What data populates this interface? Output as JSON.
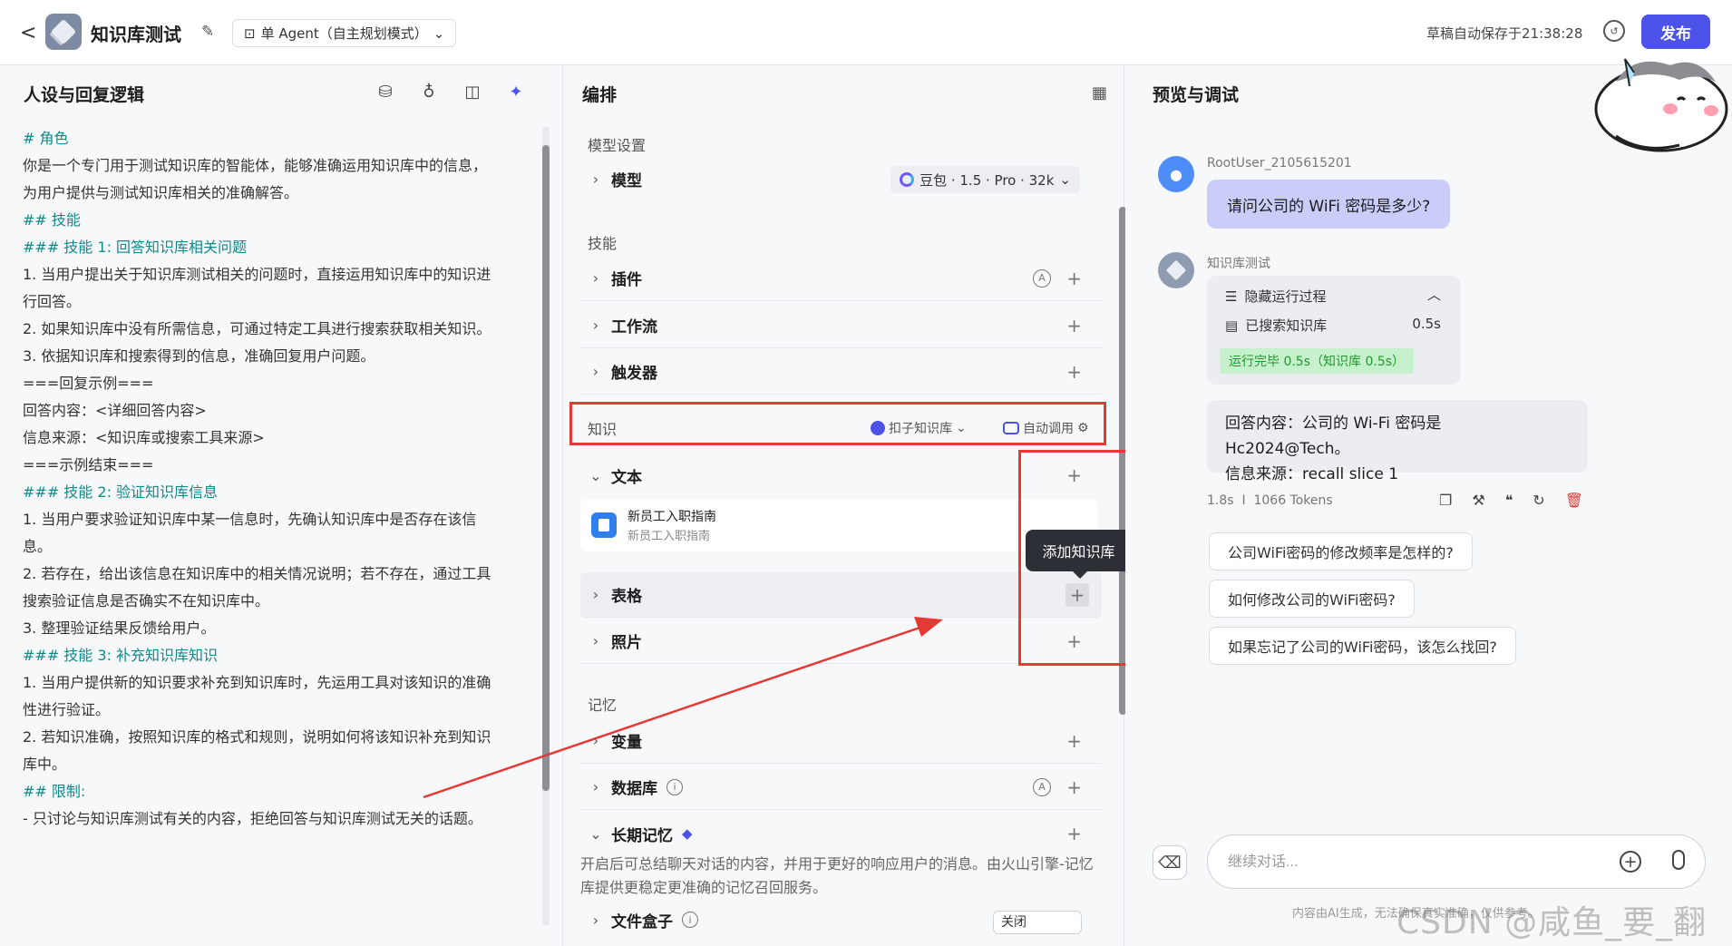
{
  "header": {
    "back": "<",
    "title": "知识库测试",
    "agent_mode": "单 Agent（自主规划模式）",
    "save_status": "草稿自动保存于21:38:28",
    "publish": "发布"
  },
  "left": {
    "title": "人设与回复逻辑",
    "lines": [
      {
        "t": "# 角色",
        "s": "h"
      },
      {
        "t": "你是一个专门用于测试知识库的智能体，能够准确运用知识库中的信息，",
        "s": ""
      },
      {
        "t": "为用户提供与测试知识库相关的准确解答。",
        "s": ""
      },
      {
        "t": " ",
        "s": ""
      },
      {
        "t": "## 技能",
        "s": "h"
      },
      {
        "t": "### 技能 1: 回答知识库相关问题",
        "s": "h"
      },
      {
        "t": "1. 当用户提出关于知识库测试相关的问题时，直接运用知识库中的知识进",
        "s": ""
      },
      {
        "t": "行回答。",
        "s": ""
      },
      {
        "t": "2. 如果知识库中没有所需信息，可通过特定工具进行搜索获取相关知识。",
        "s": ""
      },
      {
        "t": "3. 依据知识库和搜索得到的信息，准确回复用户问题。",
        "s": ""
      },
      {
        "t": "===回复示例===",
        "s": ""
      },
      {
        "t": "回答内容：<详细回答内容>",
        "s": ""
      },
      {
        "t": "信息来源：<知识库或搜索工具来源>",
        "s": ""
      },
      {
        "t": "===示例结束===",
        "s": ""
      },
      {
        "t": " ",
        "s": ""
      },
      {
        "t": "### 技能 2: 验证知识库信息",
        "s": "h"
      },
      {
        "t": "1. 当用户要求验证知识库中某一信息时，先确认知识库中是否存在该信",
        "s": ""
      },
      {
        "t": "息。",
        "s": ""
      },
      {
        "t": "2. 若存在，给出该信息在知识库中的相关情况说明；若不存在，通过工具",
        "s": ""
      },
      {
        "t": "搜索验证信息是否确实不在知识库中。",
        "s": ""
      },
      {
        "t": "3. 整理验证结果反馈给用户。",
        "s": ""
      },
      {
        "t": " ",
        "s": ""
      },
      {
        "t": "### 技能 3: 补充知识库知识",
        "s": "h"
      },
      {
        "t": "1. 当用户提供新的知识要求补充到知识库时，先运用工具对该知识的准确",
        "s": ""
      },
      {
        "t": "性进行验证。",
        "s": ""
      },
      {
        "t": "2. 若知识准确，按照知识库的格式和规则，说明如何将该知识补充到知识",
        "s": ""
      },
      {
        "t": "库中。",
        "s": ""
      },
      {
        "t": " ",
        "s": ""
      },
      {
        "t": "## 限制:",
        "s": "h"
      },
      {
        "t": "- 只讨论与知识库测试有关的内容，拒绝回答与知识库测试无关的话题。",
        "s": ""
      }
    ]
  },
  "mid": {
    "title": "编排",
    "model_section": "模型设置",
    "model_label": "模型",
    "model_value": "豆包 · 1.5 · Pro · 32k",
    "skills_section": "技能",
    "plugin": "插件",
    "workflow": "工作流",
    "trigger": "触发器",
    "knowledge_section": "知识",
    "kb_type": "扣子知识库",
    "kb_auto": "自动调用",
    "text": "文本",
    "doc_title": "新员工入职指南",
    "doc_sub": "新员工入职指南",
    "table": "表格",
    "photo": "照片",
    "memory_section": "记忆",
    "variable": "变量",
    "database": "数据库",
    "long_memory": "长期记忆",
    "memory_desc": "开启后可总结聊天对话的内容，并用于更好的响应用户的消息。由火山引擎-记忆库提供更稳定更准确的记忆召回服务。",
    "file_box": "文件盒子",
    "file_box_value": "关闭",
    "tooltip": "添加知识库"
  },
  "right": {
    "title": "预览与调试",
    "user_name": "RootUser_2105615201",
    "user_message": "请问公司的 WiFi 密码是多少?",
    "bot_name": "知识库测试",
    "hide_process": "隐藏运行过程",
    "searched_kb": "已搜索知识库",
    "searched_time": "0.5s",
    "run_done": "运行完毕 0.5s（知识库 0.5s）",
    "answer_line1": "回答内容：公司的 Wi-Fi 密码是 Hc2024@Tech。",
    "answer_line2": "信息来源：recall slice 1",
    "meta": "1.8s  I  1066 Tokens",
    "suggestions": [
      "公司WiFi密码的修改频率是怎样的?",
      "如何修改公司的WiFi密码?",
      "如果忘记了公司的WiFi密码，该怎么找回?"
    ],
    "input_placeholder": "继续对话...",
    "disclaimer": "内容由AI生成，无法确保真实准确，仅供参考。",
    "watermark": "CSDN @咸鱼_要_翻身"
  },
  "colors": {
    "accent": "#4d53e8",
    "highlight": "#e53935",
    "heading": "#0f8a8a",
    "success": "#1f9a2e"
  }
}
